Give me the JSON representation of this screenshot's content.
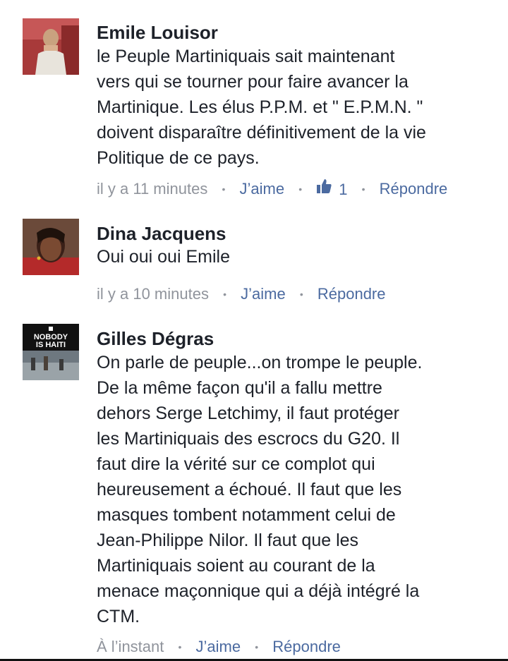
{
  "comments": [
    {
      "author": "Emile Louisor",
      "lines": [
        "le Peuple Martiniquais sait maintenant",
        "vers qui se tourner pour faire avancer la",
        "Martinique. Les élus P.P.M. et \" E.P.M.N. \"",
        "doivent disparaître définitivement de la vie",
        "Politique de ce pays."
      ],
      "time": "il y a 11 minutes",
      "like_label": "J’aime",
      "like_count": "1",
      "reply_label": "Répondre",
      "avatar_icon": "person-photo"
    },
    {
      "author": "Dina Jacquens",
      "lines": [
        "Oui oui oui Emile"
      ],
      "time": "il y a 10 minutes",
      "like_label": "J’aime",
      "reply_label": "Répondre",
      "avatar_icon": "person-photo"
    },
    {
      "author": "Gilles Dégras",
      "lines": [
        "On parle  de peuple...on trompe le peuple.",
        "De la même façon qu'il a fallu mettre",
        "dehors Serge Letchimy,   il  faut protéger",
        "les Martiniquais des escrocs du G20. Il",
        "faut dire la  vérité sur ce complot qui",
        "heureusement a échoué. Il faut que les",
        "masques tombent notamment celui de",
        "Jean-Philippe Nilor.  Il faut  que les",
        "Martiniquais soient au courant de la",
        "menace maçonnique qui a déjà intégré la",
        "CTM."
      ],
      "time": "À l’instant",
      "like_label": "J’aime",
      "reply_label": "Répondre",
      "avatar_text_line1": "NOBODY",
      "avatar_text_line2": "IS HAITI"
    }
  ],
  "colors": {
    "name": "#1d2129",
    "text": "#1d2129",
    "meta": "#90949c",
    "link": "#4b6aa0"
  }
}
